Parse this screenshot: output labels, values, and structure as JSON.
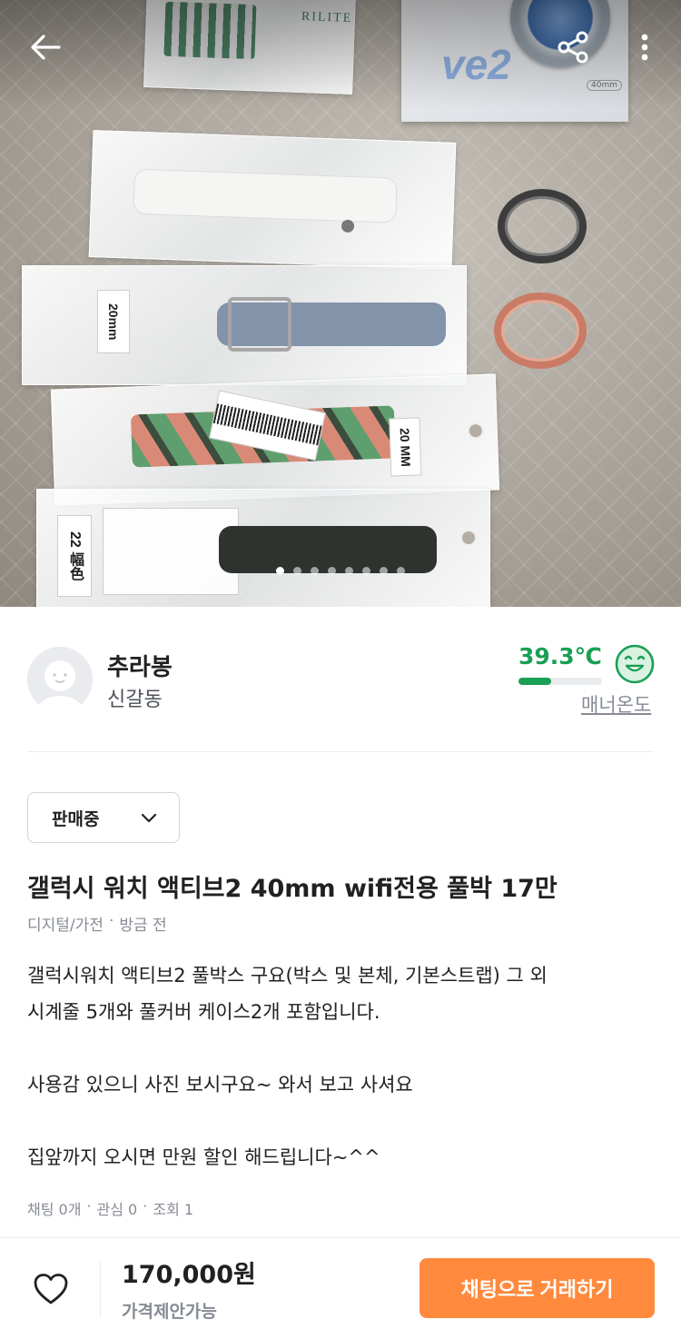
{
  "topbar": {
    "back_icon": "back-arrow-icon",
    "share_icon": "share-icon",
    "more_icon": "more-vertical-icon"
  },
  "photo": {
    "bag_labels": [
      "20mm",
      "20 MM",
      "22 幅色"
    ],
    "box_text": "ve2",
    "box_size": "40mm",
    "pager_total": 8,
    "pager_active": 0
  },
  "seller": {
    "name": "추라봉",
    "location": "신갈동",
    "temperature": "39.3℃",
    "temperature_fill": 0.393,
    "temperature_icon": "smile-face-icon",
    "temperature_label": "매너온도"
  },
  "status": {
    "label": "판매중"
  },
  "post": {
    "title": "갤럭시 워치 액티브2 40mm wifi전용 풀박 17만",
    "category": "디지털/가전",
    "time": "방금 전",
    "body": [
      "갤럭시워치 액티브2 풀박스 구요(박스 및 본체, 기본스트랩) 그 외",
      "시계줄 5개와 풀커버 케이스2개 포함입니다.",
      "",
      "사용감 있으니 사진 보시구요~ 와서 보고 사셔요",
      "",
      "집앞까지 오시면 만원 할인 해드립니다~^^"
    ],
    "chats": "채팅 0개",
    "likes": "관심 0",
    "views": "조회 1"
  },
  "bottom": {
    "heart_icon": "heart-outline-icon",
    "price": "170,000원",
    "negotiable": "가격제안가능",
    "chat_button": "채팅으로 거래하기"
  },
  "colors": {
    "accent": "#ff8a3d",
    "temperature": "#1a9f55",
    "text": "#212124",
    "muted": "#868b94"
  }
}
